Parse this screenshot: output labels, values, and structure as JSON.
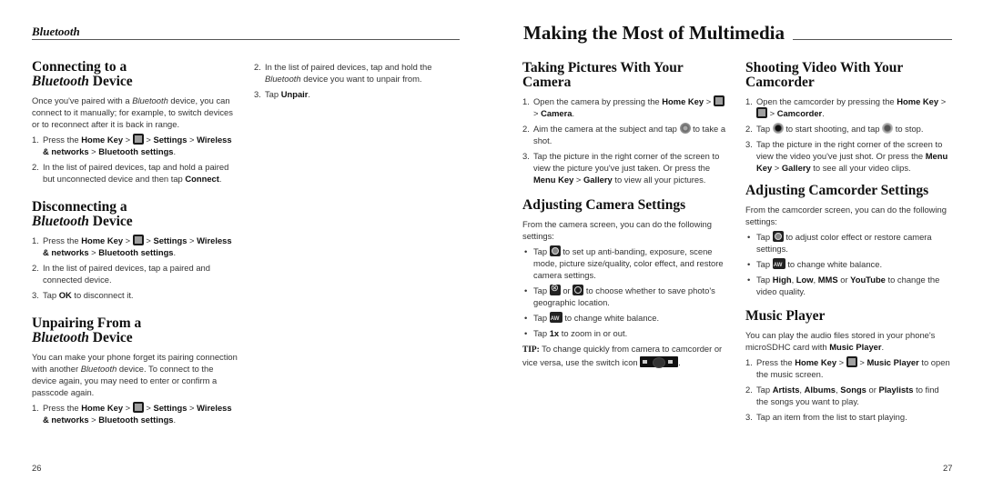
{
  "left_page": {
    "running_head": "Bluetooth",
    "page_number": "26",
    "sections": {
      "connecting": {
        "title_line1": "Connecting to a",
        "title_italic": "Bluetooth",
        "title_rest": " Device",
        "intro_a": "Once you've paired with a ",
        "intro_italic": "Bluetooth",
        "intro_b": " device, you can connect to it manually; for example, to switch devices or to reconnect after it is back in range.",
        "steps": [
          {
            "num": "1.",
            "a": "Press the ",
            "b1": "Home Key",
            "c": " > ",
            "icon": "grid-icon",
            "d": " > ",
            "b2": "Settings",
            "e": " > ",
            "b3": "Wireless & networks",
            "f": " > ",
            "b4": "Bluetooth settings",
            "g": "."
          },
          {
            "num": "2.",
            "a": "In the list of paired devices, tap and hold a paired but unconnected device and then tap ",
            "b1": "Connect",
            "g": "."
          }
        ]
      },
      "disconnecting": {
        "title_line1": "Disconnecting a",
        "title_italic": "Bluetooth",
        "title_rest": " Device",
        "steps": [
          {
            "num": "1.",
            "a": "Press the ",
            "b1": "Home Key",
            "c": " > ",
            "d": " > ",
            "b2": "Settings",
            "e": " > ",
            "b3": "Wireless & networks",
            "f": " > ",
            "b4": "Bluetooth settings",
            "g": "."
          },
          {
            "num": "2.",
            "a": "In the list of paired devices, tap a paired and connected device."
          },
          {
            "num": "3.",
            "a": "Tap ",
            "b1": "OK",
            "g": " to disconnect it."
          }
        ]
      },
      "unpairing": {
        "title_line1": "Unpairing From a",
        "title_italic": "Bluetooth",
        "title_rest": " Device",
        "intro_a": "You can make your phone forget its pairing connection with another ",
        "intro_italic": "Bluetooth",
        "intro_b": " device. To connect to the device again, you may need to enter or confirm a passcode again.",
        "steps": [
          {
            "num": "1.",
            "a": "Press the ",
            "b1": "Home Key",
            "c": " > ",
            "d": " > ",
            "b2": "Settings",
            "e": " > ",
            "b3": "Wireless & networks",
            "f": " > ",
            "b4": "Bluetooth settings",
            "g": "."
          },
          {
            "num": "2.",
            "a": "In the list of paired devices, tap and hold the ",
            "italic": "Bluetooth",
            "b": " device you want to unpair from."
          },
          {
            "num": "3.",
            "a": "Tap ",
            "b1": "Unpair",
            "g": "."
          }
        ]
      }
    }
  },
  "right_page": {
    "chapter_title": "Making the Most of Multimedia",
    "page_number": "27",
    "sections": {
      "taking_pictures": {
        "title": "Taking Pictures With Your Camera",
        "steps": [
          {
            "num": "1.",
            "a": "Open the camera by pressing the ",
            "b1": "Home Key",
            "c": " > ",
            "d": " > ",
            "b2": "Camera",
            "g": "."
          },
          {
            "num": "2.",
            "a": "Aim the camera at the subject and tap ",
            "b": " to take a shot."
          },
          {
            "num": "3.",
            "a": "Tap the picture in the right corner of the screen to view the picture you've just taken. Or press the ",
            "b1": "Menu Key",
            "c": " > ",
            "b2": "Gallery",
            "g": " to view all your pictures."
          }
        ]
      },
      "camera_settings": {
        "title": "Adjusting Camera Settings",
        "intro": "From the camera screen, you can do the following settings:",
        "bullets": [
          {
            "a": "Tap ",
            "b": " to set up anti-banding, exposure, scene mode, picture size/quality, color effect, and restore camera settings."
          },
          {
            "a": "Tap ",
            "or": " or ",
            "b": " to choose whether to save photo's geographic location."
          },
          {
            "a": "Tap ",
            "b": " to change white balance."
          },
          {
            "a": "Tap ",
            "b1": "1x",
            "b": " to zoom in or out."
          }
        ],
        "tip_label": "TIP:",
        "tip_text": " To change quickly from camera to camcorder or vice versa, use the switch icon ",
        "tip_end": "."
      },
      "shooting_video": {
        "title": "Shooting Video With Your Camcorder",
        "steps": [
          {
            "num": "1.",
            "a": "Open the camcorder by pressing the ",
            "b1": "Home Key",
            "c": " > ",
            "d": " > ",
            "b2": "Camcorder",
            "g": "."
          },
          {
            "num": "2.",
            "a": "Tap ",
            "b": " to start shooting, and tap ",
            "c": " to stop."
          },
          {
            "num": "3.",
            "a": "Tap the picture in the right corner of the screen to view the video you've just shot. Or press the ",
            "b1": "Menu Key",
            "c": " > ",
            "b2": "Gallery",
            "g": " to see all your video clips."
          }
        ]
      },
      "camcorder_settings": {
        "title": "Adjusting Camcorder Settings",
        "intro": "From the camcorder screen, you can do the following settings:",
        "bullets": [
          {
            "a": "Tap ",
            "b": " to adjust color effect or restore camera settings."
          },
          {
            "a": "Tap ",
            "b": " to change white balance."
          },
          {
            "a": "Tap ",
            "b1": "High",
            "s1": ", ",
            "b2": "Low",
            "s2": ", ",
            "b3": "MMS",
            "s3": " or ",
            "b4": "YouTube",
            "g": " to change the video quality."
          }
        ]
      },
      "music_player": {
        "title": "Music Player",
        "intro_a": "You can play the audio files stored in your phone's microSDHC card with ",
        "intro_b": "Music Player",
        "intro_c": ".",
        "steps": [
          {
            "num": "1.",
            "a": "Press the ",
            "b1": "Home Key",
            "c": " > ",
            "d": " > ",
            "b2": "Music Player",
            "g": " to open the music screen."
          },
          {
            "num": "2.",
            "a": "Tap ",
            "b1": "Artists",
            "s1": ", ",
            "b2": "Albums",
            "s2": ", ",
            "b3": "Songs",
            "s3": " or ",
            "b4": "Playlists",
            "g": " to find the songs you want to play."
          },
          {
            "num": "3.",
            "a": "Tap an item from the list to start playing."
          }
        ]
      }
    }
  }
}
